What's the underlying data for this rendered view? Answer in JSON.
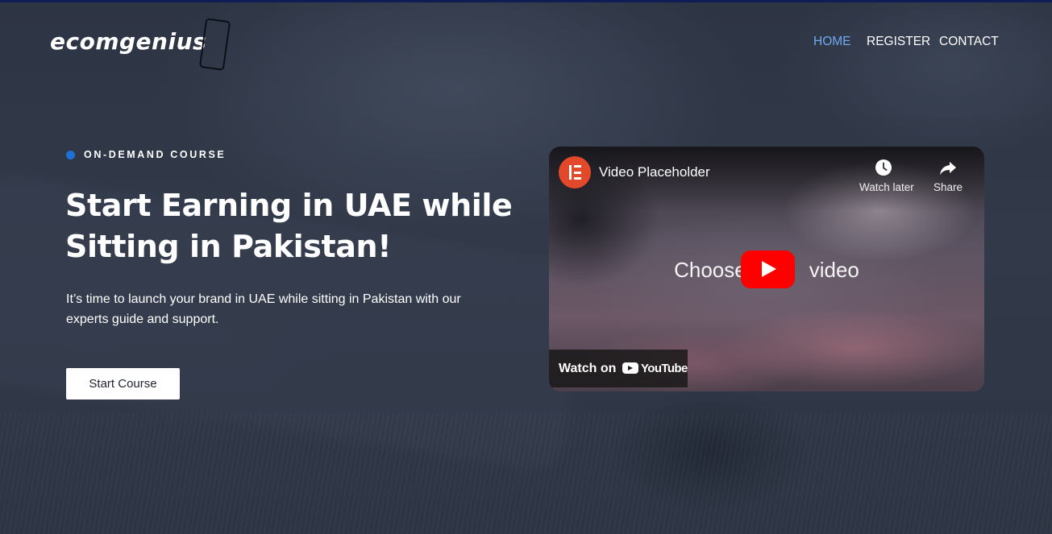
{
  "brand": {
    "logo_text": "ecomgenius"
  },
  "nav": {
    "items": [
      {
        "label": "HOME",
        "active": true
      },
      {
        "label": "REGISTER",
        "active": false
      },
      {
        "label": "CONTACT",
        "active": false
      }
    ]
  },
  "hero": {
    "eyebrow": "ON-DEMAND COURSE",
    "headline_line1": "Start Earning in UAE while",
    "headline_line2": "Sitting in Pakistan!",
    "subtext": "It’s time to launch your brand in UAE while sitting in Pakistan with our experts guide and support.",
    "cta_label": "Start Course"
  },
  "video": {
    "title": "Video Placeholder",
    "watch_later_label": "Watch later",
    "share_label": "Share",
    "center_text_before": "Choose",
    "center_text_after": "video",
    "watch_on_label": "Watch on",
    "youtube_label": "YouTube"
  },
  "colors": {
    "accent_blue": "#1f6fd6",
    "nav_active": "#6eaaf0",
    "youtube_red": "#ff0000",
    "channel_avatar": "#e2492b"
  },
  "icons": [
    "clock-icon",
    "share-icon",
    "play-icon",
    "youtube-icon",
    "elementor-icon"
  ]
}
